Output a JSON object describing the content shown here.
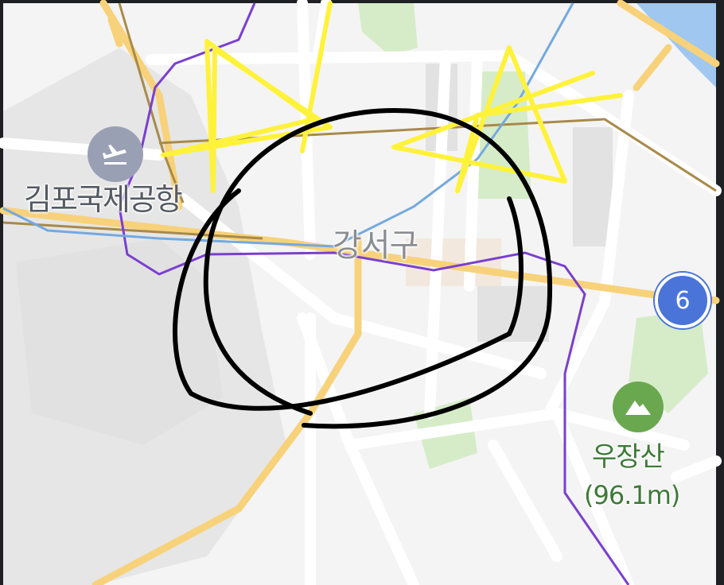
{
  "map": {
    "colors": {
      "land": "#f4f4f4",
      "airport_area": "#e6e6e6",
      "park": "#d6ecc8",
      "water": "#9fc7ef",
      "road": "#ffffff",
      "major_road": "#f7d27a",
      "subway_purple": "#7a3fd0",
      "subway_blue": "#74a9df",
      "rail_brown": "#a88a4a",
      "route_shield": "#4a74d8"
    },
    "labels": {
      "airport": "김포국제공항",
      "district": "강서구",
      "mountain_name": "우장산",
      "mountain_height": "(96.1m)"
    },
    "route_shield": {
      "number": "6"
    },
    "icons": {
      "airport": "airplane-icon",
      "mountain": "mountain-icon"
    },
    "annotations": {
      "stars": {
        "count": 2,
        "color": "#fff23a"
      },
      "circle": {
        "color": "#000000"
      }
    }
  }
}
